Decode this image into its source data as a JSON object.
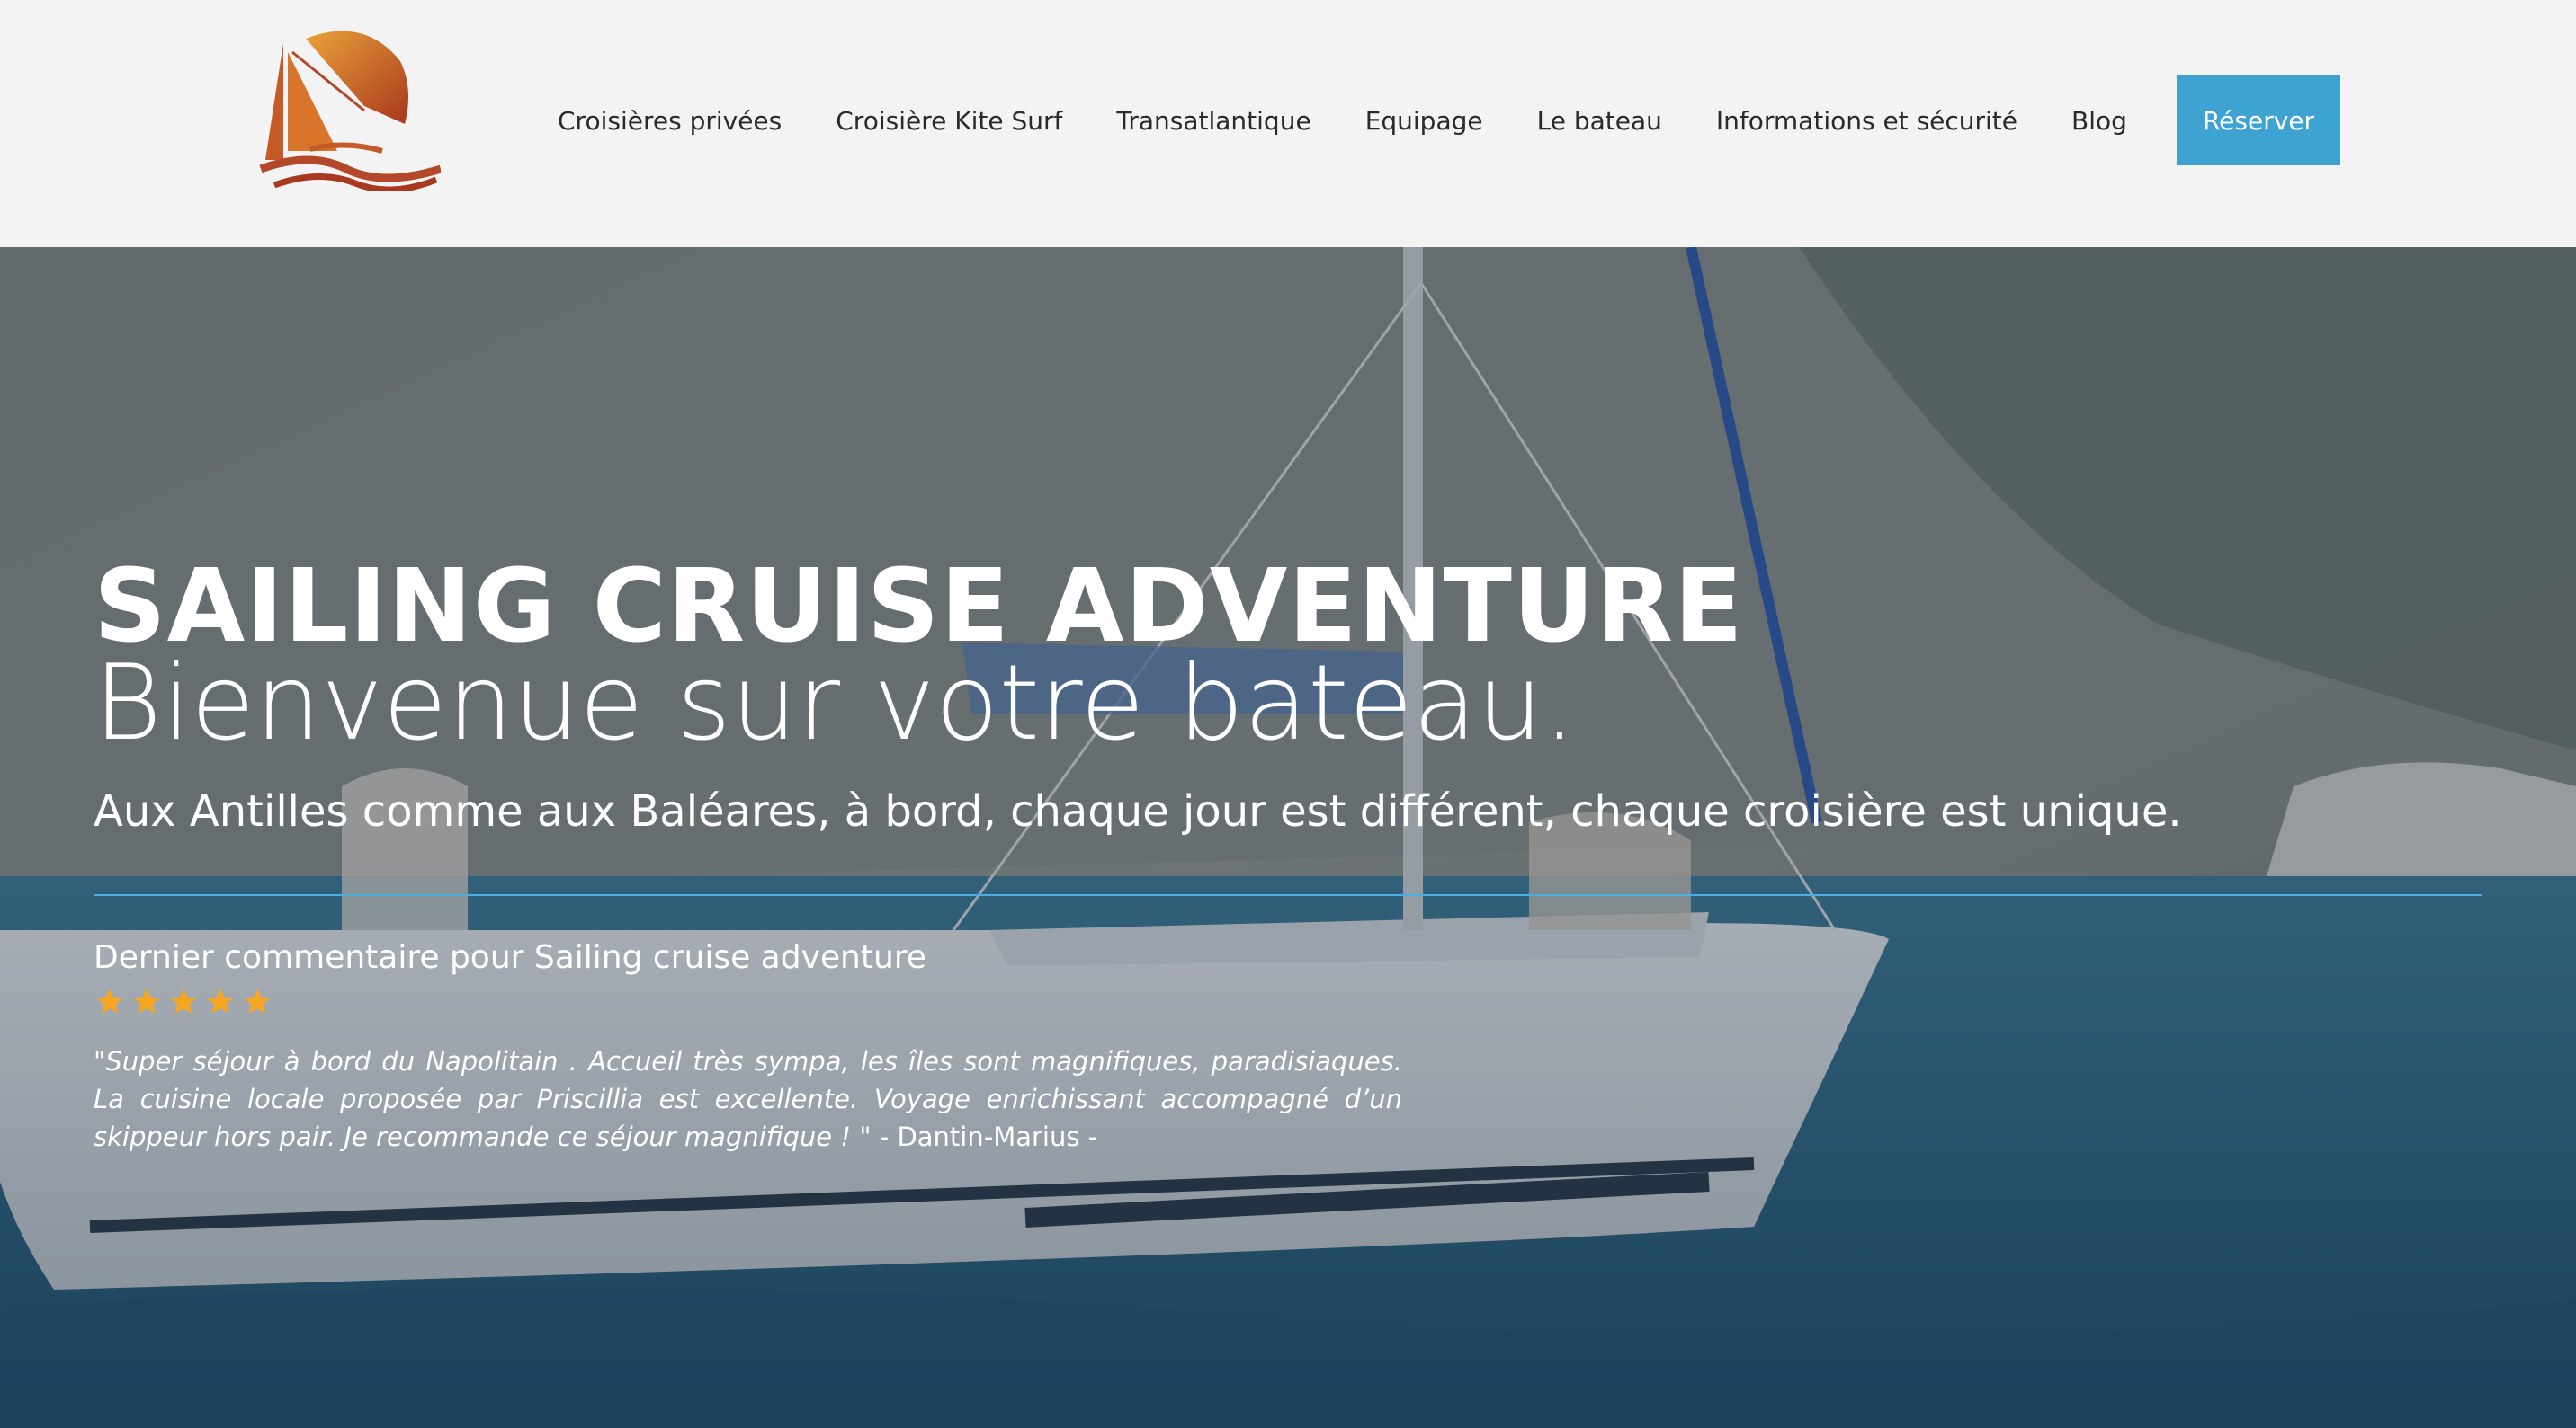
{
  "nav": {
    "items": [
      {
        "label": "Croisières privées"
      },
      {
        "label": "Croisière Kite Surf"
      },
      {
        "label": "Transatlantique"
      },
      {
        "label": "Equipage"
      },
      {
        "label": "Le bateau"
      },
      {
        "label": "Informations et sécurité"
      },
      {
        "label": "Blog"
      }
    ],
    "cta_label": "Réserver"
  },
  "hero": {
    "title": "SAILING CRUISE ADVENTURE",
    "subtitle": "Bienvenue sur votre bateau.",
    "tagline": "Aux Antilles comme aux Baléares, à bord, chaque jour est différent, chaque croisière est unique."
  },
  "review": {
    "heading": "Dernier commentaire pour Sailing cruise adventure",
    "rating": 5,
    "rating_max": 5,
    "quote": "\"Super séjour à bord du Napolitain . Accueil très sympa, les îles sont magnifiques, paradisiaques. La cuisine locale proposée par Priscillia est excellente. Voyage enrichissant accompagné d’un skippeur hors pair. Je recommande ce séjour magnifique ! \"",
    "author": " - Dantin-Marius -"
  },
  "colors": {
    "accent": "#3fa3d2",
    "divider": "#4ab0e4",
    "star": "#f5a623",
    "logo_orange": "#d9752a"
  },
  "icons": {
    "logo": "sailboat-kite-logo",
    "star": "star-icon"
  }
}
